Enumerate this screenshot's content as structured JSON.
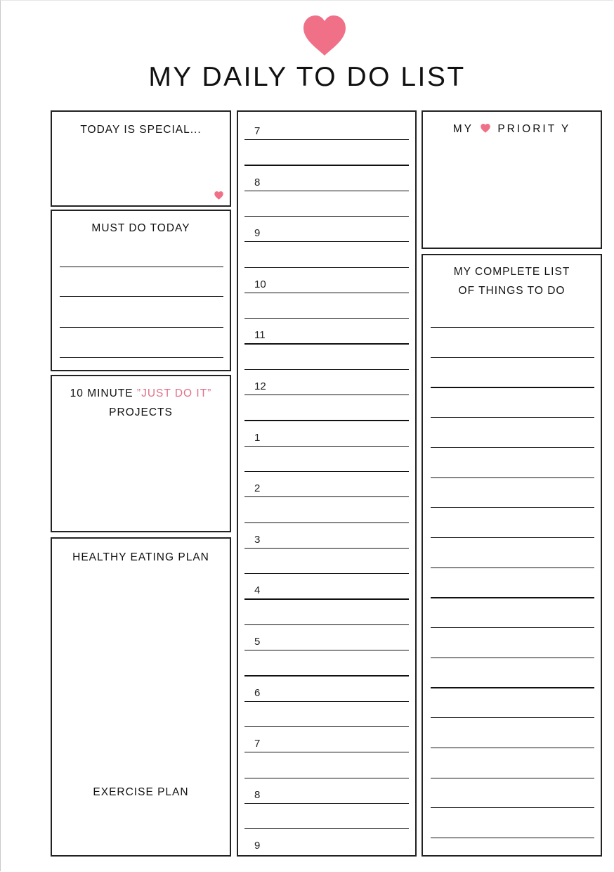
{
  "page": {
    "title": "MY DAILY TO DO LIST",
    "accent_color": "#f07088",
    "icons": {
      "header": "heart-icon",
      "special_corner": "heart-icon",
      "priority_inline": "heart-icon"
    }
  },
  "left_column": {
    "today_special": {
      "title": "TODAY IS SPECIAL..."
    },
    "must_do": {
      "title": "MUST DO TODAY",
      "lines": 4
    },
    "just_do_it": {
      "title_prefix": "10 MINUTE ",
      "title_highlight": "”JUST DO IT”",
      "title_suffix": "PROJECTS"
    },
    "healthy_eating": {
      "title": "HEALTHY EATING PLAN",
      "exercise_title": "EXERCISE PLAN"
    }
  },
  "schedule": {
    "hours": [
      "7",
      "8",
      "9",
      "10",
      "11",
      "12",
      "1",
      "2",
      "3",
      "4",
      "5",
      "6",
      "7",
      "8",
      "9"
    ]
  },
  "right_column": {
    "priority": {
      "title_before": "MY",
      "title_after": "PRIORIT Y"
    },
    "complete_list": {
      "title_line1": "MY COMPLETE LIST",
      "title_line2": "OF THINGS TO DO",
      "lines": 18
    }
  }
}
